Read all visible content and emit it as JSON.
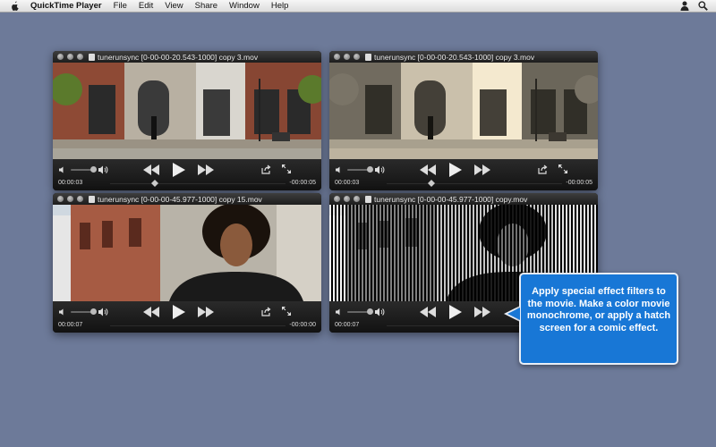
{
  "menubar": {
    "app_name": "QuickTime Player",
    "items": [
      "File",
      "Edit",
      "View",
      "Share",
      "Window",
      "Help"
    ]
  },
  "windows": [
    {
      "title": "tunerunsync [0-00-00-20.543-1000] copy 3.mov",
      "elapsed": "00:00:03",
      "remaining": "-00:00:05",
      "filter": "normal"
    },
    {
      "title": "tunerunsync [0-00-00-20.543-1000] copy 3.mov",
      "elapsed": "00:00:03",
      "remaining": "-00:00:05",
      "filter": "sepia"
    },
    {
      "title": "tunerunsync [0-00-00-45.977-1000] copy 15.mov",
      "elapsed": "00:00:07",
      "remaining": "-00:00:00",
      "filter": "normal"
    },
    {
      "title": "tunerunsync [0-00-00-45.977-1000] copy.mov",
      "elapsed": "00:00:07",
      "remaining": "",
      "filter": "hatch"
    }
  ],
  "tooltip": {
    "text": "Apply special effect filters to the movie. Make a color movie monochrome, or apply a hatch screen for a comic effect."
  },
  "colors": {
    "desktop": "#6d7a99",
    "tooltip_bg": "#1877d6"
  },
  "icons": [
    "apple-icon",
    "user-icon",
    "spotlight-icon",
    "volume-low-icon",
    "volume-high-icon",
    "rewind-icon",
    "play-icon",
    "fast-forward-icon",
    "share-icon",
    "fullscreen-icon"
  ]
}
